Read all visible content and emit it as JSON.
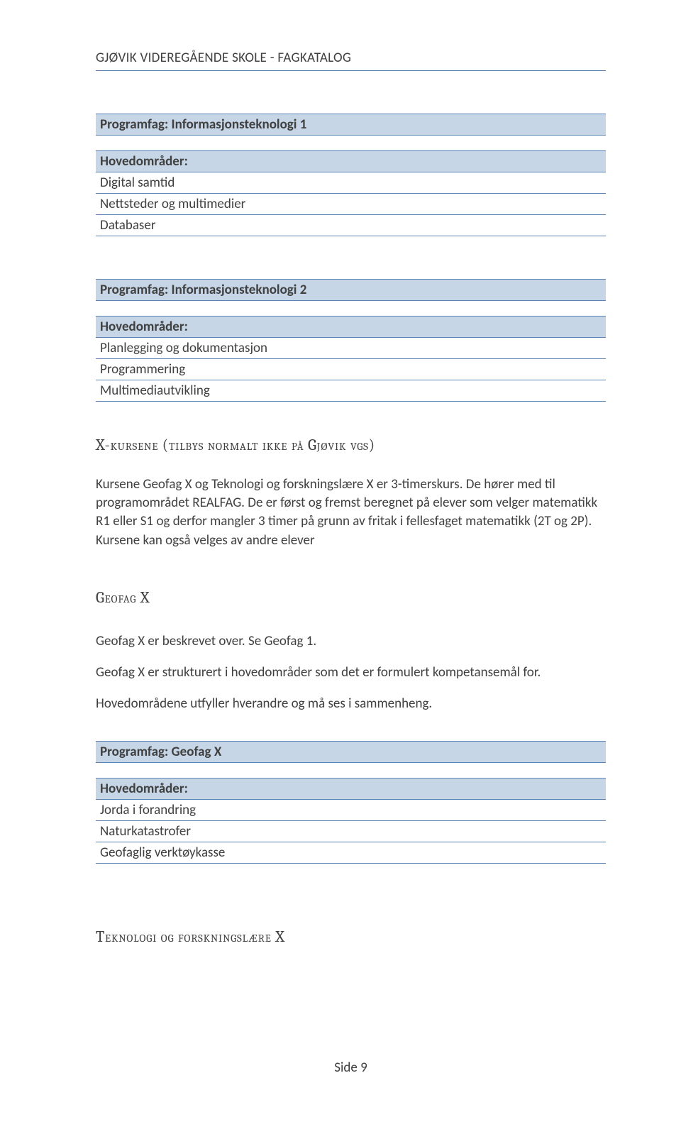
{
  "header": "GJØVIK VIDEREGÅENDE SKOLE - FAGKATALOG",
  "block1": {
    "title": "Programfag: Informasjonsteknologi 1",
    "subhead": "Hovedområder:",
    "rows": [
      "Digital samtid",
      "Nettsteder og multimedier",
      "Databaser"
    ]
  },
  "block2": {
    "title": "Programfag: Informasjonsteknologi 2",
    "subhead": "Hovedområder:",
    "rows": [
      "Planlegging og dokumentasjon",
      "Programmering",
      "Multimediautvikling"
    ]
  },
  "xkursene": {
    "heading": "X-kursene (tilbys normalt ikke på Gjøvik vgs)",
    "para": "Kursene Geofag X og Teknologi og forskningslære X er 3-timerskurs.  De hører med til programområdet REALFAG.  De er først og fremst beregnet på elever som velger matematikk R1 eller S1 og derfor mangler 3 timer på grunn av fritak i fellesfaget matematikk (2T og 2P). Kursene kan også velges av andre elever"
  },
  "geofag": {
    "heading": "Geofag X",
    "p1": "Geofag X er beskrevet over.  Se Geofag 1.",
    "p2": "Geofag X er strukturert i hovedområder som det er formulert kompetansemål for.",
    "p3": "Hovedområdene utfyller hverandre og må ses i sammenheng."
  },
  "block3": {
    "title": "Programfag: Geofag X",
    "subhead": "Hovedområder:",
    "rows": [
      "Jorda i forandring",
      "Naturkatastrofer",
      "Geofaglig verktøykasse"
    ]
  },
  "last_heading": "Teknologi og forskningslære X",
  "footer": "Side 9"
}
